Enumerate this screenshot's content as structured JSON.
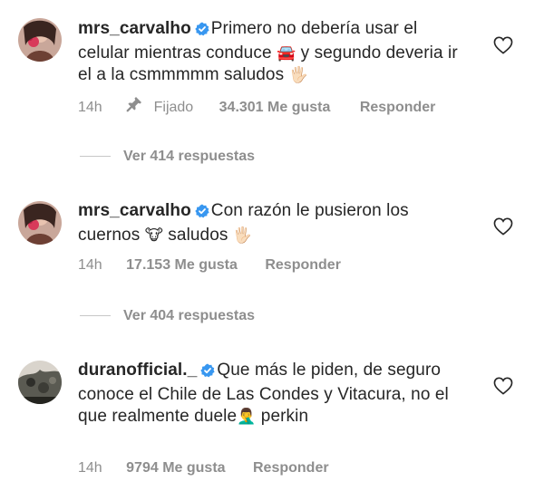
{
  "comments": [
    {
      "username": "mrs_carvalho",
      "verified": true,
      "text_parts": [
        "Primero no debería usar el celular mientras conduce ",
        "🚘",
        "  y segundo deveria ir el a la csmmmmm saludos ",
        "🖐🏻"
      ],
      "time": "14h",
      "pinned_label": "Fijado",
      "likes": "34.301 Me gusta",
      "reply_label": "Responder",
      "view_replies": "Ver 414 respuestas"
    },
    {
      "username": "mrs_carvalho",
      "verified": true,
      "text_parts": [
        "Con razón le pusieron los cuernos ",
        "🐮",
        " saludos ",
        "🖐🏻"
      ],
      "time": "14h",
      "likes": "17.153 Me gusta",
      "reply_label": "Responder",
      "view_replies": "Ver 404 respuestas"
    },
    {
      "username": "duranofficial._",
      "verified": true,
      "text_parts": [
        "Que más le piden, de seguro conoce el Chile de Las Condes y Vitacura, no el que realmente duele",
        "🤦‍♂️",
        " perkin"
      ],
      "time": "14h",
      "likes": "9794 Me gusta",
      "reply_label": "Responder"
    }
  ],
  "colors": {
    "text": "#262626",
    "muted": "#8e8e8e",
    "verified_blue": "#3897f0"
  }
}
